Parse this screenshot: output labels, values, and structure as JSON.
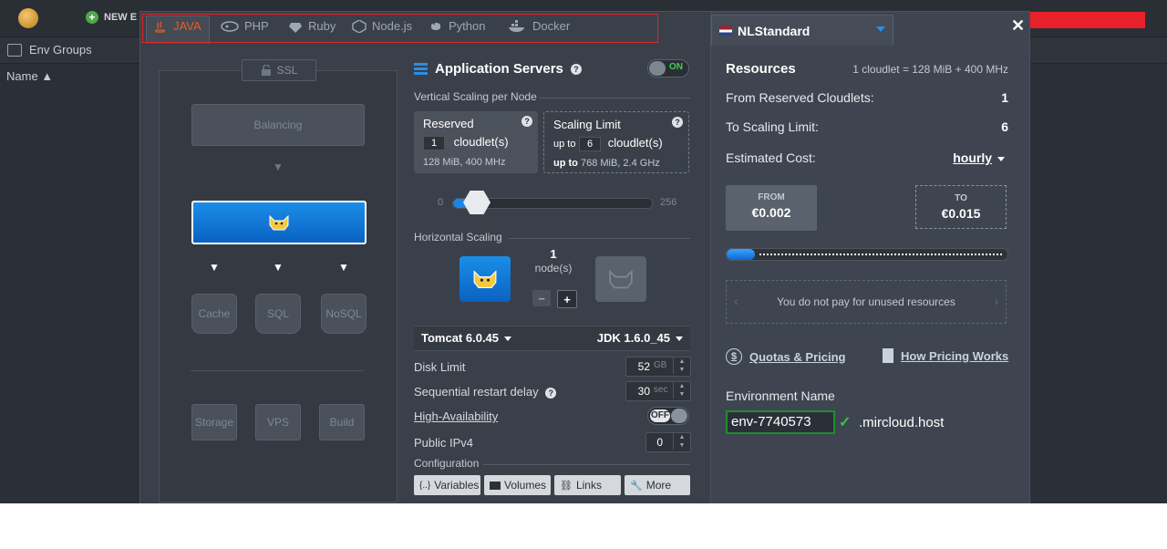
{
  "topbar": {
    "new_env_label": "NEW E"
  },
  "subbar": {
    "env_groups_label": "Env Groups",
    "name_header": "Name ▲"
  },
  "tabs": [
    {
      "label": "JAVA",
      "active": true,
      "icon": "java-icon"
    },
    {
      "label": "PHP",
      "active": false,
      "icon": "php-icon"
    },
    {
      "label": "Ruby",
      "active": false,
      "icon": "ruby-icon"
    },
    {
      "label": "Node.js",
      "active": false,
      "icon": "nodejs-icon"
    },
    {
      "label": "Python",
      "active": false,
      "icon": "python-icon"
    },
    {
      "label": "Docker",
      "active": false,
      "icon": "docker-icon"
    }
  ],
  "topology": {
    "ssl_label": "SSL",
    "balancing_label": "Balancing",
    "cache_label": "Cache",
    "sql_label": "SQL",
    "nosql_label": "NoSQL",
    "storage_label": "Storage",
    "vps_label": "VPS",
    "build_label": "Build"
  },
  "app_servers": {
    "title": "Application Servers",
    "toggle": "ON",
    "vertical_label": "Vertical Scaling per Node",
    "reserved": {
      "title": "Reserved",
      "value": "1",
      "unit": "cloudlet(s)",
      "specs": "128 MiB, 400 MHz"
    },
    "limit": {
      "title": "Scaling Limit",
      "prefix": "up to",
      "value": "6",
      "unit": "cloudlet(s)",
      "specs_prefix": "up to",
      "specs": "768 MiB, 2.4 GHz"
    },
    "slider_min": "0",
    "slider_max": "256",
    "horizontal_label": "Horizontal Scaling",
    "node_count": "1",
    "node_unit": "node(s)",
    "minus": "−",
    "plus": "+",
    "server": "Tomcat 6.0.45",
    "jdk": "JDK 1.6.0_45",
    "disk_limit_label": "Disk Limit",
    "disk_limit_value": "52",
    "disk_limit_unit": "GB",
    "restart_label": "Sequential restart delay",
    "restart_value": "30",
    "restart_unit": "sec",
    "ha_label": "High-Availability",
    "ha_toggle": "OFF",
    "ipv4_label": "Public IPv4",
    "ipv4_value": "0",
    "config_label": "Configuration",
    "config_buttons": [
      "Variables",
      "Volumes",
      "Links",
      "More"
    ]
  },
  "region": {
    "name": "NLStandard"
  },
  "resources": {
    "title": "Resources",
    "note": "1 cloudlet = 128 MiB + 400 MHz",
    "reserved_label": "From Reserved Cloudlets:",
    "reserved_value": "1",
    "limit_label": "To Scaling Limit:",
    "limit_value": "6",
    "cost_label": "Estimated Cost:",
    "cost_period": "hourly",
    "from_label": "FROM",
    "from_value": "€0.002",
    "to_label": "TO",
    "to_value": "€0.015",
    "cost_fill_fraction": 0.1,
    "unused_note": "You do not pay for unused resources",
    "quotas_link": "Quotas & Pricing",
    "pricing_link": "How Pricing Works",
    "env_name_label": "Environment Name",
    "env_name_value": "env-7740573",
    "domain_suffix": ".mircloud.host"
  },
  "colors": {
    "accent_blue": "#1a86e0",
    "active_tab": "#e85a28",
    "on_green": "#3fd14a",
    "highlight_red": "#e02525"
  }
}
